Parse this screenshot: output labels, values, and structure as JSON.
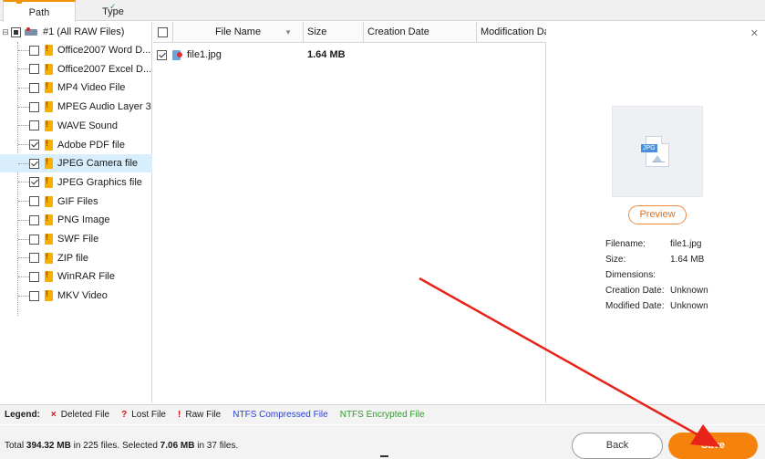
{
  "tabs": {
    "path_label": "Path",
    "type_label": "Type"
  },
  "tree": {
    "root": {
      "label": "#1 (All RAW Files)",
      "state": "partial"
    },
    "items": [
      {
        "label": "Office2007 Word D...",
        "checked": false
      },
      {
        "label": "Office2007 Excel D...",
        "checked": false
      },
      {
        "label": "MP4 Video File",
        "checked": false
      },
      {
        "label": "MPEG Audio Layer 3",
        "checked": false
      },
      {
        "label": "WAVE Sound",
        "checked": false
      },
      {
        "label": "Adobe PDF file",
        "checked": true
      },
      {
        "label": "JPEG Camera file",
        "checked": true,
        "selected": true
      },
      {
        "label": "JPEG Graphics file",
        "checked": true
      },
      {
        "label": "GIF Files",
        "checked": false
      },
      {
        "label": "PNG Image",
        "checked": false
      },
      {
        "label": "SWF File",
        "checked": false
      },
      {
        "label": "ZIP file",
        "checked": false
      },
      {
        "label": "WinRAR File",
        "checked": false
      },
      {
        "label": "MKV Video",
        "checked": false
      }
    ]
  },
  "filelist": {
    "columns": {
      "name": "File Name",
      "size": "Size",
      "creation": "Creation Date",
      "modification": "Modification Da"
    },
    "rows": [
      {
        "name": "file1.jpg",
        "size": "1.64 MB",
        "checked": true
      }
    ]
  },
  "preview": {
    "close_icon": "close-icon",
    "thumb_tag": "JPG",
    "button_label": "Preview",
    "info": [
      {
        "key": "Filename:",
        "value": "file1.jpg"
      },
      {
        "key": "Size:",
        "value": "1.64 MB"
      },
      {
        "key": "Dimensions:",
        "value": ""
      },
      {
        "key": "Creation Date:",
        "value": "Unknown"
      },
      {
        "key": "Modified Date:",
        "value": "Unknown"
      }
    ]
  },
  "legend": {
    "title": "Legend:",
    "items": [
      {
        "symbol": "×",
        "label": "Deleted File",
        "color": "#d01010"
      },
      {
        "symbol": "?",
        "label": "Lost File",
        "color": "#d01010"
      },
      {
        "symbol": "!",
        "label": "Raw File",
        "color": "#d01010"
      },
      {
        "symbol": "",
        "label": "NTFS Compressed File",
        "color": "#2a3fd8"
      },
      {
        "symbol": "",
        "label": "NTFS Encrypted File",
        "color": "#2f9a2f"
      }
    ]
  },
  "status": {
    "prefix": "Total ",
    "total_size": "394.32 MB",
    "mid1": " in 225 files.  Selected ",
    "selected_size": "7.06 MB",
    "mid2": " in 37 files."
  },
  "buttons": {
    "back_label": "Back",
    "save_label": "Save"
  },
  "colors": {
    "accent": "#f5820d",
    "selection": "#d9eefc",
    "annotation_arrow": "#e8231a"
  }
}
